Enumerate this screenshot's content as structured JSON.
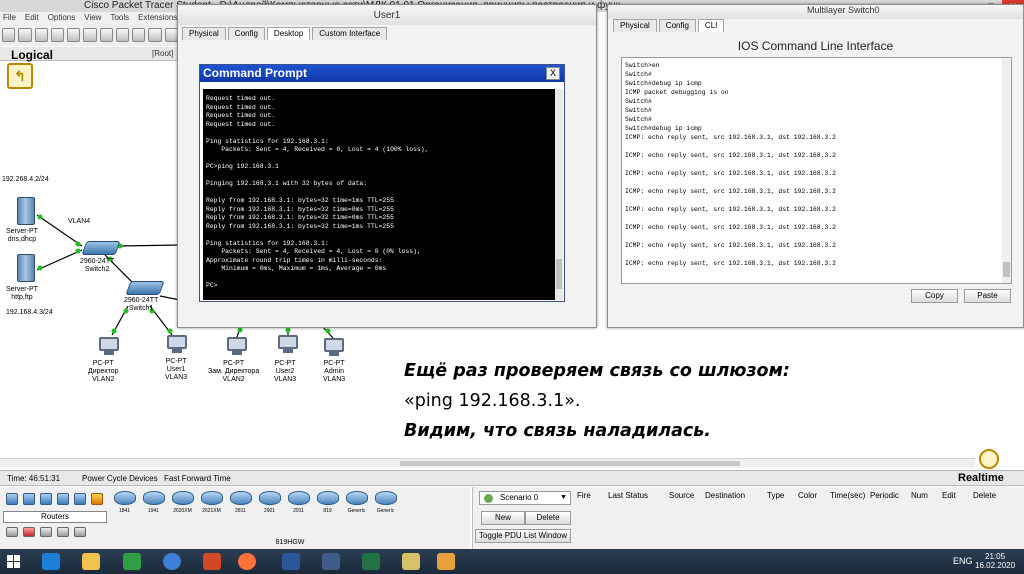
{
  "packet_tracer": {
    "title": "Cisco Packet Tracer Student - D:\\Андрей\\Компьютерные сети\\МДК.01.01 Организация, принципы построения и функ",
    "menu": [
      "File",
      "Edit",
      "Options",
      "View",
      "Tools",
      "Extensions",
      "H"
    ],
    "logical_label": "Logical",
    "root_label": "[Root]",
    "time": "Time: 46:51:31",
    "power_cycle": "Power Cycle Devices",
    "fast_forward": "Fast Forward Time",
    "realtime": "Realtime",
    "device_category": "Routers",
    "device_model_name": "819HGW",
    "device_models": [
      "1841",
      "1941",
      "2620XM",
      "2621XM",
      "2811",
      "2901",
      "2911",
      "819",
      "Generic",
      "Generic"
    ]
  },
  "topology": {
    "net_top": "192.268.4.2/24",
    "net_bottom": "192.168.4.3/24",
    "vlan4": "VLAN4",
    "server1": {
      "type": "Server-PT",
      "name": "dns,dhcp"
    },
    "server2": {
      "type": "Server-PT",
      "name": "http,ftp"
    },
    "switch2": {
      "model": "2960-24TT",
      "name": "Switch2"
    },
    "switch1": {
      "model": "2960-24TT",
      "name": "Switch1"
    },
    "pcs": [
      {
        "type": "PC-PT",
        "name": "Директор",
        "vlan": "VLAN2"
      },
      {
        "type": "PC-PT",
        "name": "User1",
        "vlan": "VLAN3"
      },
      {
        "type": "PC-PT",
        "name": "Зам. Директора",
        "vlan": "VLAN2"
      },
      {
        "type": "PC-PT",
        "name": "User2",
        "vlan": "VLAN3"
      },
      {
        "type": "PC-PT",
        "name": "Admin",
        "vlan": "VLAN3"
      }
    ]
  },
  "user1_window": {
    "title": "User1",
    "tabs": [
      "Physical",
      "Config",
      "Desktop",
      "Custom Interface"
    ],
    "active_tab": "Desktop",
    "cmd_title": "Command Prompt",
    "cmd_close": "X",
    "terminal_text": "Request timed out.\nRequest timed out.\nRequest timed out.\nRequest timed out.\n\nPing statistics for 192.168.3.1:\n    Packets: Sent = 4, Received = 0, Lost = 4 (100% loss),\n\nPC>ping 192.168.3.1\n\nPinging 192.168.3.1 with 32 bytes of data:\n\nReply from 192.168.3.1: bytes=32 time=1ms TTL=255\nReply from 192.168.3.1: bytes=32 time=0ms TTL=255\nReply from 192.168.3.1: bytes=32 time=0ms TTL=255\nReply from 192.168.3.1: bytes=32 time=1ms TTL=255\n\nPing statistics for 192.168.3.1:\n    Packets: Sent = 4, Received = 4, Lost = 0 (0% loss),\nApproximate round trip times in milli-seconds:\n    Minimum = 0ms, Maximum = 1ms, Average = 0ms\n\nPC>"
  },
  "switch_window": {
    "title": "Multilayer Switch0",
    "tabs": [
      "Physical",
      "Config",
      "CLI"
    ],
    "active_tab": "CLI",
    "heading": "IOS Command Line Interface",
    "cli_text": "Switch>en\nSwitch#\nSwitch#debug ip icmp\nICMP packet debugging is on\nSwitch#\nSwitch#\nSwitch#\nSwitch#debug ip icmp\nICMP: echo reply sent, src 192.168.3.1, dst 192.168.3.2\n\nICMP: echo reply sent, src 192.168.3.1, dst 192.168.3.2\n\nICMP: echo reply sent, src 192.168.3.1, dst 192.168.3.2\n\nICMP: echo reply sent, src 192.168.3.1, dst 192.168.3.2\n\nICMP: echo reply sent, src 192.168.3.1, dst 192.168.3.2\n\nICMP: echo reply sent, src 192.168.3.1, dst 192.168.3.2\n\nICMP: echo reply sent, src 192.168.3.1, dst 192.168.3.2\n\nICMP: echo reply sent, src 192.168.3.1, dst 192.168.3.2",
    "copy_label": "Copy",
    "paste_label": "Paste"
  },
  "simulation": {
    "scenario": "Scenario 0",
    "new_label": "New",
    "delete_label": "Delete",
    "toggle_label": "Toggle PDU List Window",
    "columns": [
      "Fire",
      "Last Status",
      "Source",
      "Destination",
      "Type",
      "Color",
      "Time(sec)",
      "Periodic",
      "Num",
      "Edit",
      "Delete"
    ]
  },
  "caption": {
    "line1": "Ещё раз проверяем связь со шлюзом:",
    "line2": "«ping 192.168.3.1».",
    "line3": "Видим, что связь наладилась."
  },
  "taskbar": {
    "lang": "ENG",
    "time": "21:05",
    "date": "16.02.2020"
  }
}
